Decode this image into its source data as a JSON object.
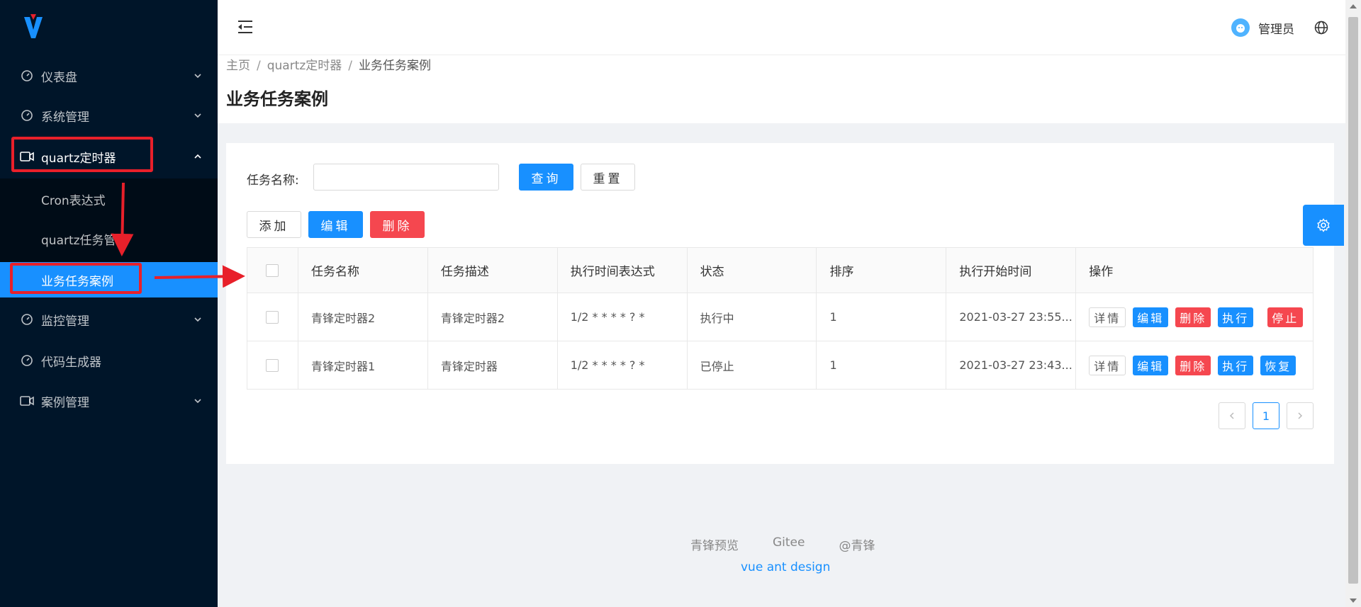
{
  "sidebar": {
    "items": [
      {
        "label": "仪表盘"
      },
      {
        "label": "系统管理"
      },
      {
        "label": "quartz定时器"
      },
      {
        "label": "监控管理"
      },
      {
        "label": "代码生成器"
      },
      {
        "label": "案例管理"
      }
    ],
    "submenu": [
      {
        "label": "Cron表达式"
      },
      {
        "label": "quartz任务管理"
      },
      {
        "label": "业务任务案例"
      }
    ]
  },
  "header": {
    "user_name": "管理员"
  },
  "breadcrumb": [
    "主页",
    "quartz定时器",
    "业务任务案例"
  ],
  "breadcrumb_sep": "/",
  "page_title": "业务任务案例",
  "search": {
    "label": "任务名称:",
    "value": "",
    "placeholder": "",
    "query_label": "查询",
    "reset_label": "重置"
  },
  "toolbar": {
    "add_label": "添加",
    "edit_label": "编辑",
    "delete_label": "删除"
  },
  "table": {
    "columns": [
      "任务名称",
      "任务描述",
      "执行时间表达式",
      "状态",
      "排序",
      "执行开始时间",
      "操作"
    ],
    "rows": [
      {
        "name": "青锋定时器2",
        "desc": "青锋定时器2",
        "cron": "1/2 * * * * ? *",
        "status": "执行中",
        "sort": "1",
        "start_time": "2021-03-27 23:55...",
        "ops": [
          "详情",
          "编辑",
          "删除",
          "执行",
          "停止"
        ]
      },
      {
        "name": "青锋定时器1",
        "desc": "青锋定时器",
        "cron": "1/2 * * * * ? *",
        "status": "已停止",
        "sort": "1",
        "start_time": "2021-03-27 23:43...",
        "ops": [
          "详情",
          "编辑",
          "删除",
          "执行",
          "恢复"
        ]
      }
    ]
  },
  "pagination": {
    "current": "1",
    "prev_icon": "chevron-left-icon",
    "next_icon": "chevron-right-icon"
  },
  "footer": {
    "links": [
      "青锋预览",
      "Gitee",
      "@青锋"
    ],
    "sub": "vue ant design"
  },
  "colors": {
    "sidebar_bg": "#001529",
    "primary": "#1890ff",
    "danger": "#f5474f",
    "annotation": "#e8202a"
  }
}
